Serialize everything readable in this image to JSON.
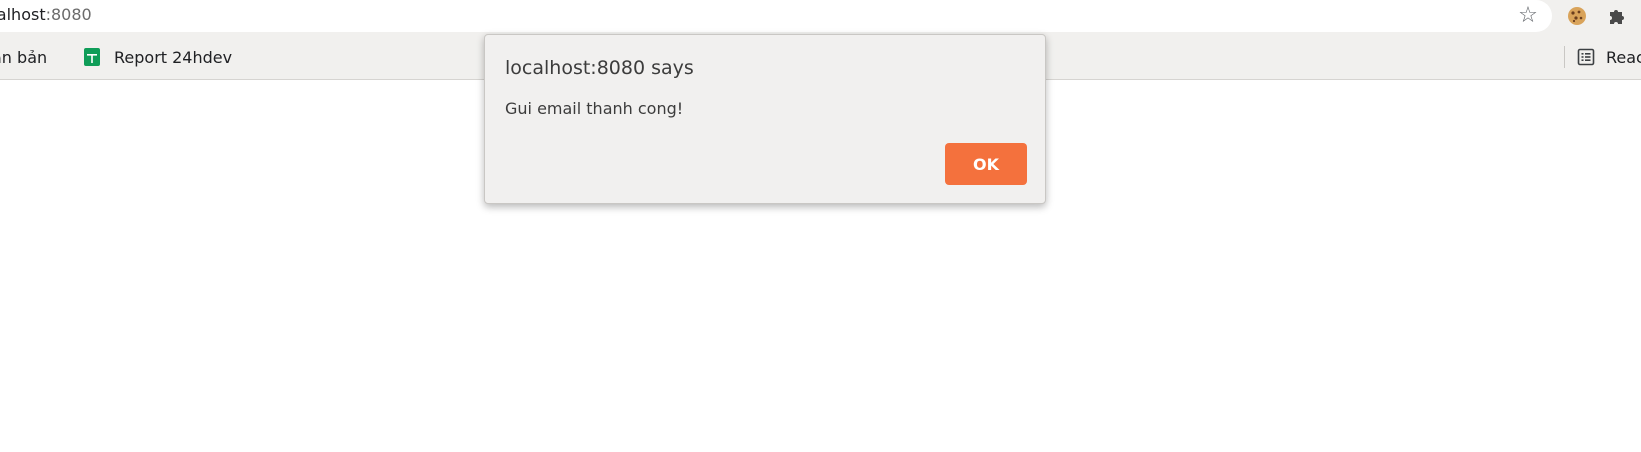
{
  "address_bar": {
    "url_host": "calhost",
    "url_port": ":8080"
  },
  "bookmarks": [
    {
      "label": "ăn bản"
    },
    {
      "label": "Report 24hdev",
      "icon": "google-sheets-icon"
    }
  ],
  "reading_list": {
    "label": "Reac",
    "icon": "reading-list-icon"
  },
  "toolbar_icons": [
    "star-icon",
    "cookie-extension-icon",
    "puzzle-extensions-icon"
  ],
  "dialog": {
    "title": "localhost:8080 says",
    "message": "Gui email thanh cong!",
    "ok_label": "OK"
  },
  "colors": {
    "ok_button": "#f4713d",
    "dialog_bg": "#f1f0ef",
    "toolbar_bg": "#f1f0ee",
    "sheets_green": "#0f9d58"
  }
}
